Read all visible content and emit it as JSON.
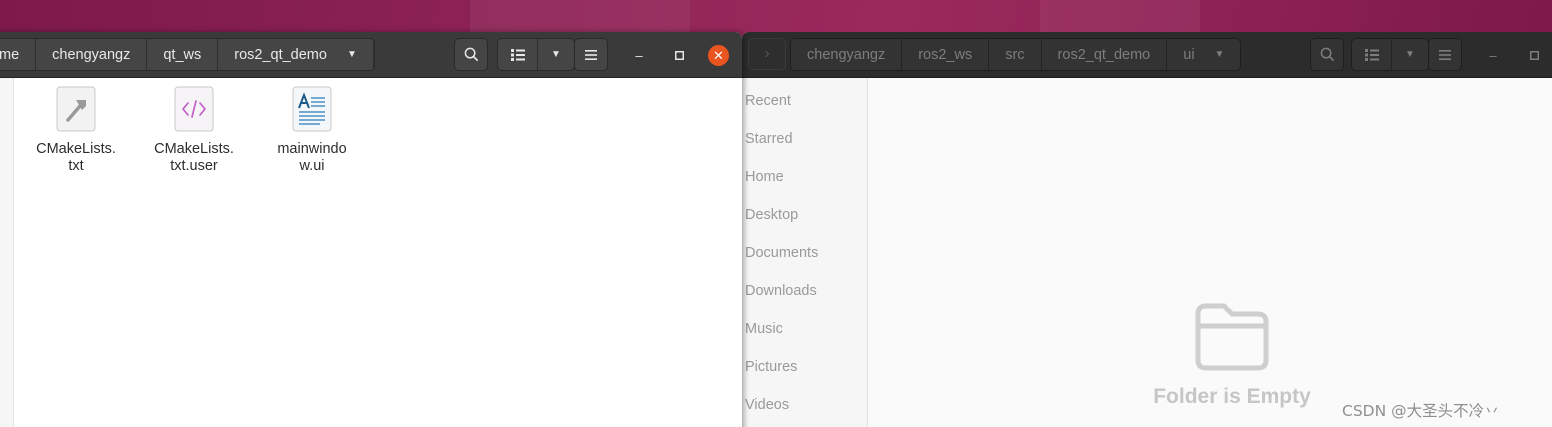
{
  "right_window": {
    "breadcrumbs": [
      "chengyangz",
      "ros2_ws",
      "src",
      "ros2_qt_demo",
      "ui"
    ],
    "sidebar": [
      "Recent",
      "Starred",
      "Home",
      "Desktop",
      "Documents",
      "Downloads",
      "Music",
      "Pictures",
      "Videos"
    ],
    "empty_message": "Folder is Empty",
    "watermark": "CSDN @大圣头不冷丷"
  },
  "left_window": {
    "breadcrumbs": [
      "me",
      "chengyangz",
      "qt_ws",
      "ros2_qt_demo"
    ],
    "files": [
      {
        "name": "CMakeLists.txt",
        "icon": "cmake-file-icon"
      },
      {
        "name": "CMakeLists.txt.user",
        "icon": "code-file-icon"
      },
      {
        "name": "mainwindow.ui",
        "icon": "document-file-icon"
      }
    ]
  },
  "colors": {
    "desktop": "#8c1e52",
    "close_button": "#e95420",
    "headerbar_active": "#3a3a3a",
    "headerbar_inactive": "#2c2c2c"
  }
}
